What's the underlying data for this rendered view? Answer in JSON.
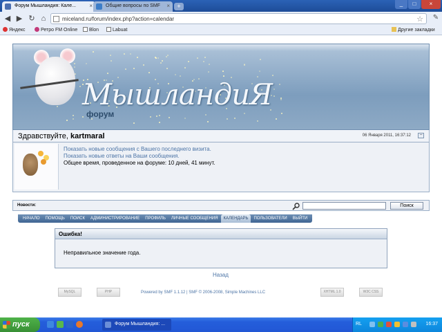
{
  "browser": {
    "tabs": [
      {
        "label": "Форум Мышландия: Кале...",
        "active": true
      },
      {
        "label": "Общие вопросы по SMF",
        "active": false
      }
    ],
    "new_tab_label": "+",
    "url": "miceland.ru/forum/index.php?action=calendar",
    "bookmarks": [
      "Яндекс",
      "Ретро FM Online",
      "Blon",
      "Labuat"
    ],
    "other_bookmarks": "Другие закладки"
  },
  "forum": {
    "logo_text": "МышландиЯ",
    "logo_subtitle": "форум",
    "greeting_prefix": "Здравствуйте,",
    "username": "kartmaral",
    "datetime": "06 Января 2011, 16:37:12",
    "collapse_symbol": "−",
    "links": {
      "new_posts": "Показать новые сообщения с Вашего последнего визита.",
      "new_replies": "Показать новые ответы на Ваши сообщения.",
      "online_time": "Общее время, проведенное на форуме: 10 дней, 41 минут."
    },
    "news_label": "Новости:",
    "search_button": "Поиск",
    "menu": [
      {
        "label": "НАЧАЛО",
        "active": false
      },
      {
        "label": "ПОМОЩЬ",
        "active": false
      },
      {
        "label": "ПОИСК",
        "active": false
      },
      {
        "label": "АДМИНИСТРИРОВАНИЕ",
        "active": false
      },
      {
        "label": "ПРОФИЛЬ",
        "active": false
      },
      {
        "label": "ЛИЧНЫЕ СООБЩЕНИЯ",
        "active": false
      },
      {
        "label": "КАЛЕНДАРЬ",
        "active": true
      },
      {
        "label": "ПОЛЬЗОВАТЕЛИ",
        "active": false
      },
      {
        "label": "ВЫЙТИ",
        "active": false
      }
    ],
    "error": {
      "title": "Ошибка!",
      "message": "Неправильное значение года."
    },
    "back_link": "Назад",
    "powered_by": "Powered by SMF 1.1.12 | SMF © 2006-2008, Simple Machines LLC",
    "badges": [
      "MySQL",
      "PHP",
      "XHTML 1.0",
      "W3C CSS"
    ]
  },
  "taskbar": {
    "start_label": "пуск",
    "task_label": "Форум Мышландия: ...",
    "lang": "RL",
    "clock": "16:37"
  },
  "colors": {
    "link": "#4c74a6",
    "header_blue": "#7d9dbd",
    "menu_blue": "#3f6593",
    "taskbar_blue": "#245edb",
    "start_green": "#4fb24a"
  }
}
